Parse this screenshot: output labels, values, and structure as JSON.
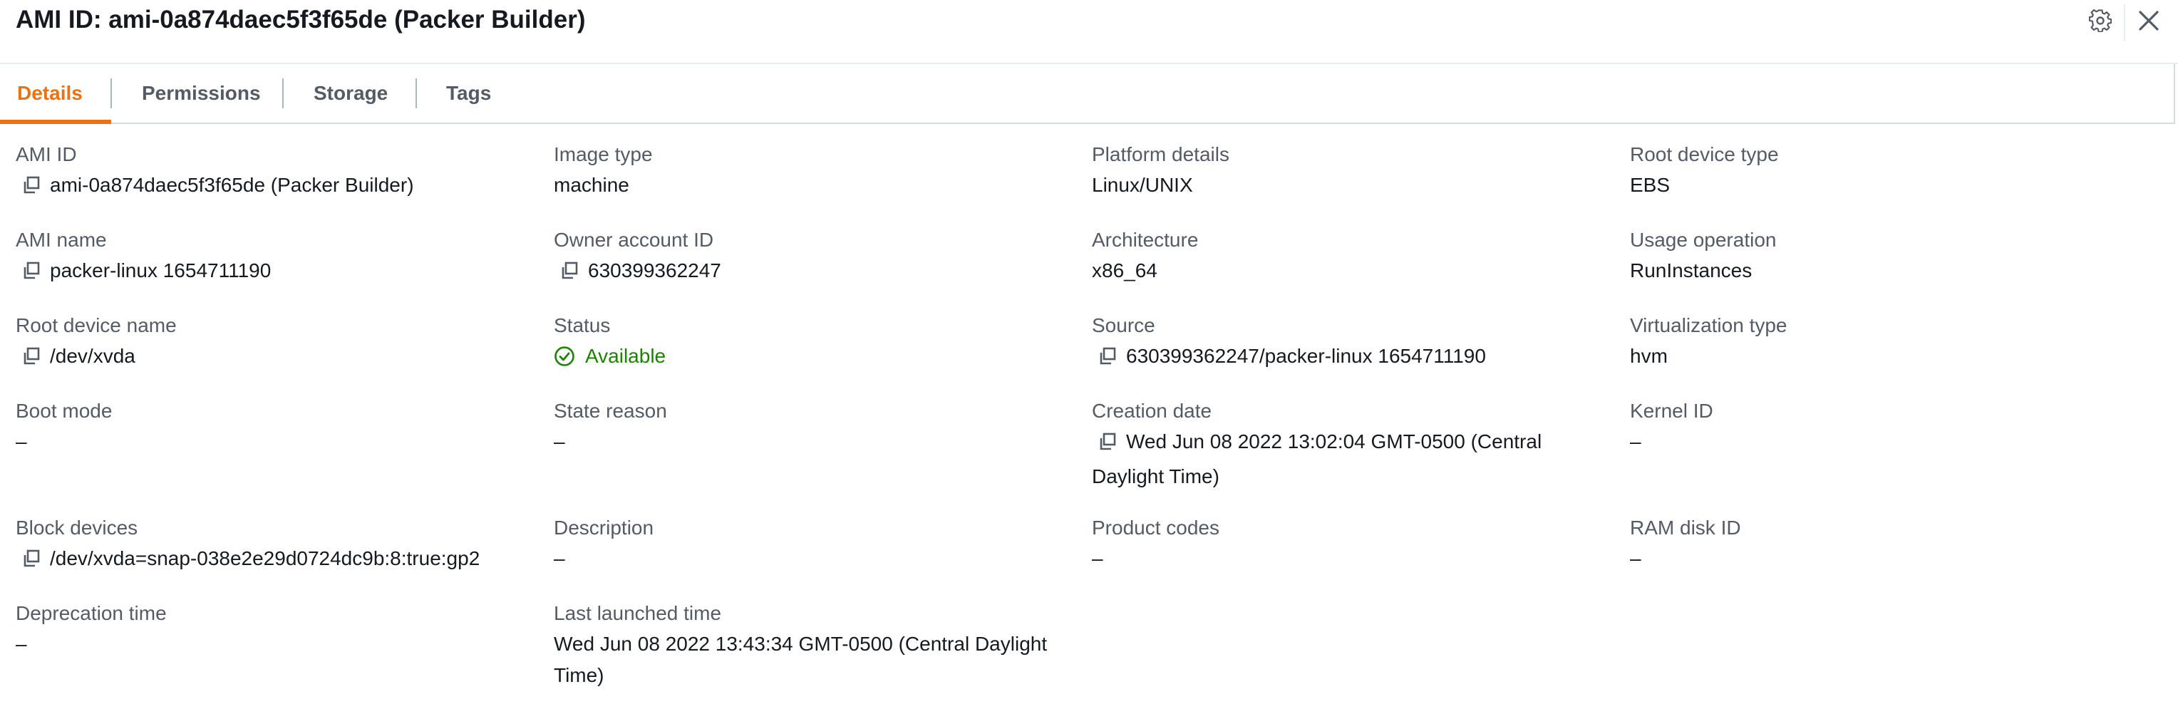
{
  "header": {
    "title": "AMI ID: ami-0a874daec5f3f65de (Packer Builder)",
    "settings_icon": "gear-icon",
    "close_icon": "close-icon"
  },
  "tabs": [
    {
      "label": "Details",
      "active": true
    },
    {
      "label": "Permissions",
      "active": false
    },
    {
      "label": "Storage",
      "active": false
    },
    {
      "label": "Tags",
      "active": false
    }
  ],
  "colors": {
    "accent": "#ec7211",
    "status_available": "#1d8102",
    "label": "#545b64",
    "text": "#16191f"
  },
  "details": {
    "ami_id": {
      "label": "AMI ID",
      "value": "ami-0a874daec5f3f65de (Packer Builder)"
    },
    "image_type": {
      "label": "Image type",
      "value": "machine"
    },
    "platform_details": {
      "label": "Platform details",
      "value": "Linux/UNIX"
    },
    "root_device_type": {
      "label": "Root device type",
      "value": "EBS"
    },
    "ami_name": {
      "label": "AMI name",
      "value": "packer-linux 1654711190"
    },
    "owner_account_id": {
      "label": "Owner account ID",
      "value": "630399362247"
    },
    "architecture": {
      "label": "Architecture",
      "value": "x86_64"
    },
    "usage_operation": {
      "label": "Usage operation",
      "value": "RunInstances"
    },
    "root_device_name": {
      "label": "Root device name",
      "value": "/dev/xvda"
    },
    "status": {
      "label": "Status",
      "value": "Available",
      "icon": "check-circle-icon"
    },
    "source": {
      "label": "Source",
      "value": "630399362247/packer-linux 1654711190"
    },
    "virtualization_type": {
      "label": "Virtualization type",
      "value": "hvm"
    },
    "boot_mode": {
      "label": "Boot mode",
      "value": "–"
    },
    "state_reason": {
      "label": "State reason",
      "value": "–"
    },
    "creation_date": {
      "label": "Creation date",
      "value": "Wed Jun 08 2022 13:02:04 GMT-0500 (Central Daylight Time)"
    },
    "kernel_id": {
      "label": "Kernel ID",
      "value": "–"
    },
    "block_devices": {
      "label": "Block devices",
      "value": "/dev/xvda=snap-038e2e29d0724dc9b:8:true:gp2"
    },
    "description": {
      "label": "Description",
      "value": "–"
    },
    "product_codes": {
      "label": "Product codes",
      "value": "–"
    },
    "ram_disk_id": {
      "label": "RAM disk ID",
      "value": "–"
    },
    "deprecation_time": {
      "label": "Deprecation time",
      "value": "–"
    },
    "last_launched_time": {
      "label": "Last launched time",
      "value": "Wed Jun 08 2022 13:43:34 GMT-0500 (Central Daylight Time)"
    }
  }
}
